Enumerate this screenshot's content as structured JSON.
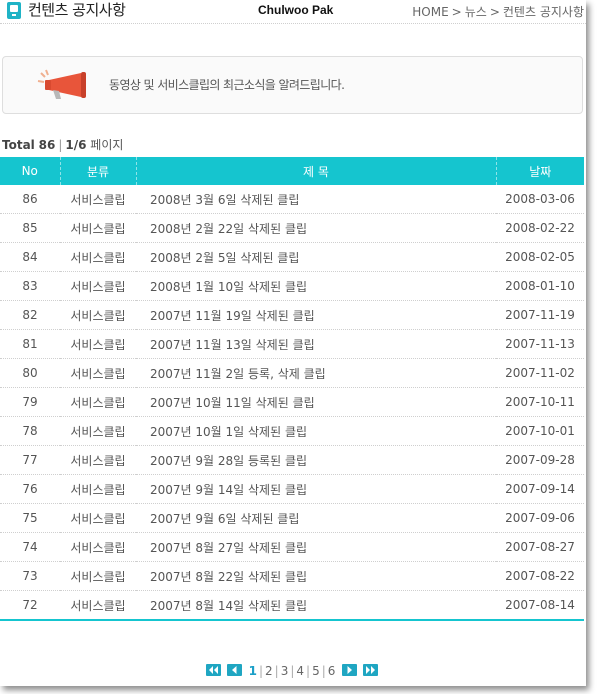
{
  "header": {
    "title": "컨텐츠 공지사항",
    "watermark": "Chulwoo Pak",
    "breadcrumb": [
      "HOME",
      "뉴스",
      "컨텐츠 공지사항"
    ],
    "separator": ">"
  },
  "banner": {
    "icon": "megaphone-icon",
    "text": "동영상 및 서비스클립의 최근소식을 알려드립니다."
  },
  "summary": {
    "total_label": "Total",
    "total_count": "86",
    "divider": "|",
    "page_info": "1/6",
    "page_word": "페이지"
  },
  "table": {
    "columns": [
      "No",
      "분류",
      "제 목",
      "날짜"
    ],
    "rows": [
      {
        "no": "86",
        "category": "서비스클립",
        "title": "2008년 3월 6일 삭제된 클립",
        "date": "2008-03-06"
      },
      {
        "no": "85",
        "category": "서비스클립",
        "title": "2008년 2월 22일 삭제된 클립",
        "date": "2008-02-22"
      },
      {
        "no": "84",
        "category": "서비스클립",
        "title": "2008년 2월 5일 삭제된 클립",
        "date": "2008-02-05"
      },
      {
        "no": "83",
        "category": "서비스클립",
        "title": "2008년 1월 10일 삭제된 클립",
        "date": "2008-01-10"
      },
      {
        "no": "82",
        "category": "서비스클립",
        "title": "2007년 11월 19일 삭제된 클립",
        "date": "2007-11-19"
      },
      {
        "no": "81",
        "category": "서비스클립",
        "title": "2007년 11월 13일 삭제된 클립",
        "date": "2007-11-13"
      },
      {
        "no": "80",
        "category": "서비스클립",
        "title": "2007년 11월 2일 등록, 삭제 클립",
        "date": "2007-11-02"
      },
      {
        "no": "79",
        "category": "서비스클립",
        "title": "2007년 10월 11일 삭제된 클립",
        "date": "2007-10-11"
      },
      {
        "no": "78",
        "category": "서비스클립",
        "title": "2007년 10월 1일 삭제된 클립",
        "date": "2007-10-01"
      },
      {
        "no": "77",
        "category": "서비스클립",
        "title": "2007년 9월 28일 등록된 클립",
        "date": "2007-09-28"
      },
      {
        "no": "76",
        "category": "서비스클립",
        "title": "2007년 9월 14일 삭제된 클립",
        "date": "2007-09-14"
      },
      {
        "no": "75",
        "category": "서비스클립",
        "title": "2007년 9월 6일 삭제된 클립",
        "date": "2007-09-06"
      },
      {
        "no": "74",
        "category": "서비스클립",
        "title": "2007년 8월 27일 삭제된 클립",
        "date": "2007-08-27"
      },
      {
        "no": "73",
        "category": "서비스클립",
        "title": "2007년 8월 22일 삭제된 클립",
        "date": "2007-08-22"
      },
      {
        "no": "72",
        "category": "서비스클립",
        "title": "2007년 8월 14일 삭제된 클립",
        "date": "2007-08-14"
      }
    ]
  },
  "pagination": {
    "first_icon": "double-chevron-left-icon",
    "prev_icon": "chevron-left-icon",
    "next_icon": "chevron-right-icon",
    "last_icon": "double-chevron-right-icon",
    "pages": [
      "1",
      "2",
      "3",
      "4",
      "5",
      "6"
    ],
    "current": "1",
    "divider": "|"
  },
  "colors": {
    "accent": "#15c5cf",
    "pager_button": "#1fa6c2",
    "megaphone": "#e8553a"
  }
}
